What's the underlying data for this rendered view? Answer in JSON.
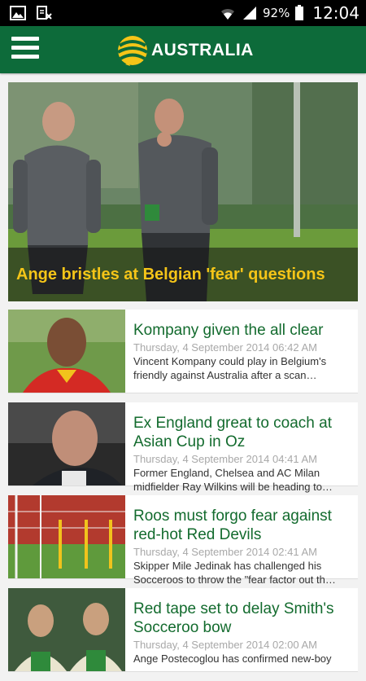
{
  "status_bar": {
    "battery_percent": "92%",
    "time": "12:04",
    "icons": [
      "image-icon",
      "download-notification-icon",
      "wifi-icon",
      "signal-icon",
      "battery-icon"
    ]
  },
  "app_bar": {
    "title": "AUSTRALIA",
    "brand_colors": {
      "bar": "#0d6b3a",
      "gold": "#f5c518"
    }
  },
  "hero": {
    "title": "Ange bristles at Belgian 'fear' questions"
  },
  "articles": [
    {
      "title": "Kompany given the all clear",
      "date": "Thursday, 4 September 2014 06:42 AM",
      "snippet": "Vincent Kompany could play in Belgium's friendly against Australia after a scan…"
    },
    {
      "title": "Ex England great to coach at Asian Cup in Oz",
      "date": "Thursday, 4 September 2014 04:41 AM",
      "snippet": "Former England, Chelsea and AC Milan midfielder Ray Wilkins will be heading to…"
    },
    {
      "title": "Roos must forgo fear against red-hot Red Devils",
      "date": "Thursday, 4 September 2014 02:41 AM",
      "snippet": "Skipper Mile Jedinak has challenged his Socceroos to throw the \"fear factor out th…"
    },
    {
      "title": "Red tape set to delay Smith's Socceroo bow",
      "date": "Thursday, 4 September 2014 02:00 AM",
      "snippet": "Ange Postecoglou has confirmed new-boy"
    }
  ]
}
